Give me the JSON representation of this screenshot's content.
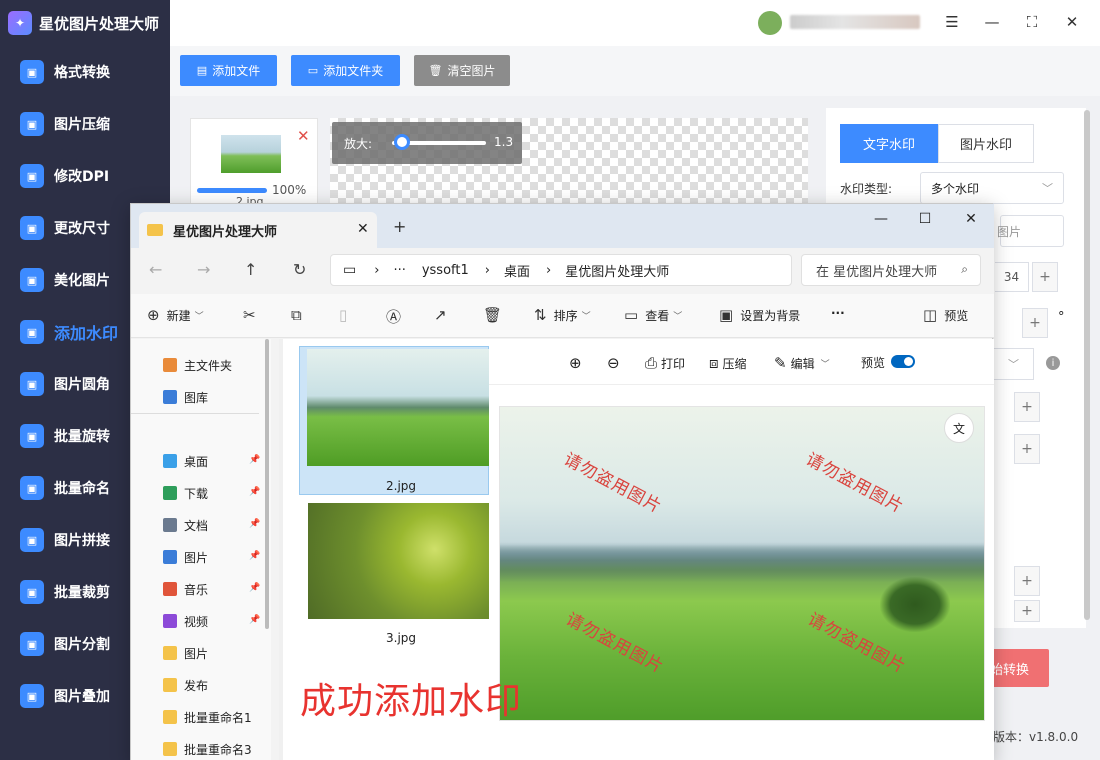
{
  "app": {
    "title": "星优图片处理大师",
    "colors": {
      "sidebar": "#2c2f45",
      "accent": "#3d8bff",
      "danger": "#f07072",
      "watermark": "#d9443e"
    }
  },
  "sidebar": {
    "items": [
      {
        "label": "格式转换",
        "icon": "image-format-icon"
      },
      {
        "label": "图片压缩",
        "icon": "compress-icon"
      },
      {
        "label": "修改DPI",
        "icon": "dpi-icon"
      },
      {
        "label": "更改尺寸",
        "icon": "resize-icon"
      },
      {
        "label": "美化图片",
        "icon": "beautify-icon"
      },
      {
        "label": "添加水印",
        "icon": "watermark-icon",
        "active": true
      },
      {
        "label": "图片圆角",
        "icon": "round-corner-icon"
      },
      {
        "label": "批量旋转",
        "icon": "rotate-icon"
      },
      {
        "label": "批量命名",
        "icon": "rename-icon"
      },
      {
        "label": "图片拼接",
        "icon": "puzzle-icon"
      },
      {
        "label": "批量裁剪",
        "icon": "crop-icon"
      },
      {
        "label": "图片分割",
        "icon": "split-icon"
      },
      {
        "label": "图片叠加",
        "icon": "layers-icon"
      }
    ]
  },
  "toolbar": {
    "add_file": "添加文件",
    "add_folder": "添加文件夹",
    "clear": "清空图片"
  },
  "thumb": {
    "progress": "100%",
    "progress_value": 1.0,
    "name": "2.jpg"
  },
  "zoom": {
    "label": "放大:",
    "value": "1.3"
  },
  "right_panel": {
    "tab_text": "文字水印",
    "tab_image": "图片水印",
    "type_label": "水印类型:",
    "type_value": "多个水印",
    "text_placeholder": "图片",
    "font_size": "34",
    "degree": "°"
  },
  "convert_button": "始转换",
  "version": "版本：v1.8.0.0",
  "explorer": {
    "tab_title": "星优图片处理大师",
    "path": [
      "yssoft1",
      "桌面",
      "星优图片处理大师"
    ],
    "search_placeholder": "在 星优图片处理大师",
    "commands": {
      "new": "新建",
      "sort": "排序",
      "view": "查看",
      "set_bg": "设置为背景",
      "more": "···",
      "preview": "预览"
    },
    "nav_items": [
      {
        "label": "主文件夹",
        "icon": "home-icon"
      },
      {
        "label": "图库",
        "icon": "gallery-icon"
      },
      {
        "label": "桌面",
        "icon": "desktop-icon",
        "pinned": true
      },
      {
        "label": "下载",
        "icon": "download-icon",
        "pinned": true
      },
      {
        "label": "文档",
        "icon": "document-icon",
        "pinned": true
      },
      {
        "label": "图片",
        "icon": "pictures-icon",
        "pinned": true
      },
      {
        "label": "音乐",
        "icon": "music-icon",
        "pinned": true
      },
      {
        "label": "视频",
        "icon": "video-icon",
        "pinned": true
      },
      {
        "label": "图片",
        "icon": "folder-icon"
      },
      {
        "label": "发布",
        "icon": "folder-icon"
      },
      {
        "label": "批量重命名1",
        "icon": "folder-icon"
      },
      {
        "label": "批量重命名3",
        "icon": "folder-icon"
      }
    ],
    "files": [
      {
        "name": "2.jpg",
        "selected": true
      },
      {
        "name": "3.jpg",
        "selected": false
      }
    ],
    "preview_toolbar": {
      "print": "打印",
      "compress": "压缩",
      "edit": "编辑",
      "preview": "预览"
    },
    "watermark_text": "请勿盗用图片"
  },
  "overlay_text": "成功添加水印"
}
